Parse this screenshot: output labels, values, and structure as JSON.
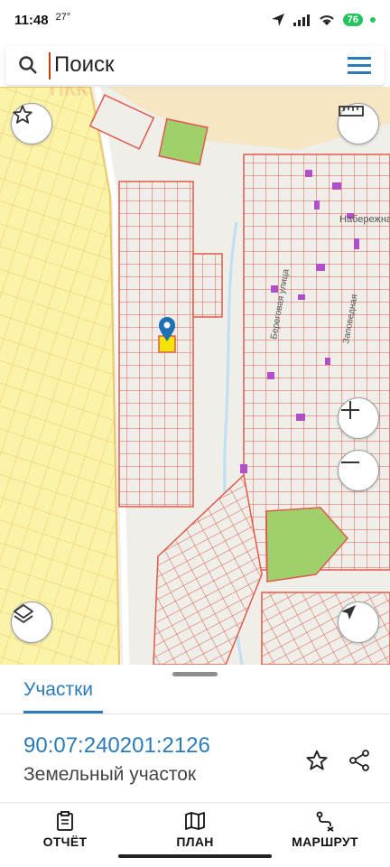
{
  "status_bar": {
    "time": "11:48",
    "temp": "27°",
    "battery": "76"
  },
  "search": {
    "placeholder": "Поиск"
  },
  "map": {
    "street_labels": [
      "Набережна",
      "Береговая улица",
      "Заповедная"
    ],
    "watermark": "ПКК"
  },
  "sheet": {
    "tab": "Участки",
    "parcel_number": "90:07:240201:2126",
    "parcel_type": "Земельный участок"
  },
  "bottom_nav": {
    "report": "ОТЧЁТ",
    "plan": "ПЛАН",
    "route": "МАРШРУТ"
  },
  "colors": {
    "accent": "#2b7bb9",
    "parcel_stroke": "#e05a4a",
    "parcel_fill_yellow": "#fbf3a8",
    "purple_building": "#b04fc7",
    "green_area": "#9fd06b"
  },
  "icons": {
    "search": "search-icon",
    "menu": "menu-icon",
    "favorite": "star-icon",
    "ruler": "ruler-icon",
    "zoom_in": "plus-icon",
    "zoom_out": "minus-icon",
    "layers": "layers-icon",
    "locate": "navigation-arrow-icon",
    "share": "share-icon",
    "report": "clipboard-icon",
    "plan": "map-icon",
    "route": "route-icon"
  }
}
